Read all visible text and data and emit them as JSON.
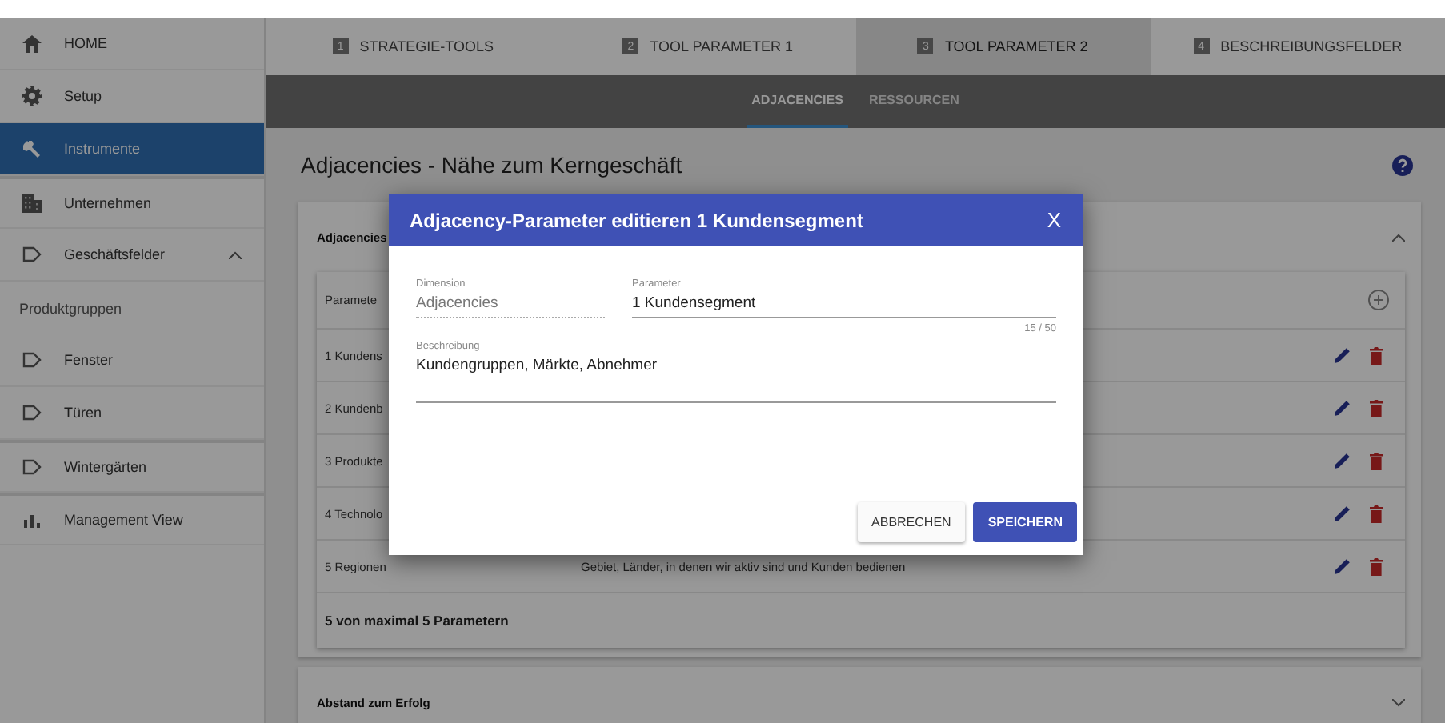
{
  "sidebar": {
    "items": [
      {
        "kind": "link",
        "label": "HOME",
        "selected": false
      },
      {
        "kind": "link",
        "label": "Setup",
        "selected": false
      },
      {
        "kind": "link",
        "label": "Instrumente",
        "selected": true
      },
      {
        "kind": "link",
        "label": "Unternehmen",
        "selected": false
      },
      {
        "kind": "group",
        "label": "Geschäftsfelder",
        "selected": false,
        "expanded": true
      },
      {
        "kind": "subheader",
        "label": "Produktgruppen"
      },
      {
        "kind": "link",
        "label": "Fenster",
        "selected": false
      },
      {
        "kind": "link",
        "label": "Türen",
        "selected": false
      },
      {
        "kind": "link",
        "label": "Wintergärten",
        "selected": false
      },
      {
        "kind": "link",
        "label": "Management View",
        "selected": false
      }
    ]
  },
  "tabs": [
    {
      "number": "1",
      "label": "STRATEGIE-TOOLS",
      "selected": false
    },
    {
      "number": "2",
      "label": "TOOL PARAMETER 1",
      "selected": false
    },
    {
      "number": "3",
      "label": "TOOL PARAMETER 2",
      "selected": true
    },
    {
      "number": "4",
      "label": "BESCHREIBUNGSFELDER",
      "selected": false
    }
  ],
  "subtabs": [
    {
      "label": "ADJACENCIES",
      "selected": true
    },
    {
      "label": "RESSOURCEN",
      "selected": false
    }
  ],
  "page_title": "Adjacencies - Nähe zum Kerngeschäft",
  "panels": [
    {
      "title": "Adjacencies",
      "expanded": true,
      "table": {
        "header": "Paramete",
        "rows": [
          {
            "label": "1 Kundens"
          },
          {
            "label": "2 Kundenb"
          },
          {
            "label": "3 Produkte"
          },
          {
            "label": "4 Technolo"
          },
          {
            "label": "5 Regionen",
            "description": "Gebiet, Länder, in denen wir aktiv sind und Kunden bedienen"
          }
        ],
        "footer": "5 von maximal 5 Parametern"
      }
    },
    {
      "title": "Abstand zum Erfolg",
      "expanded": false
    }
  ],
  "dialog": {
    "title": "Adjacency-Parameter editieren 1 Kundensegment",
    "close": "X",
    "fields": [
      {
        "label": "Dimension",
        "value": "Adjacencies",
        "disabled": true
      },
      {
        "label": "Parameter",
        "value": "1 Kundensegment",
        "disabled": false,
        "counter": "15 / 50"
      },
      {
        "label": "Beschreibung",
        "value": "Kundengruppen, Märkte, Abnehmer",
        "disabled": false
      }
    ],
    "buttons": [
      {
        "label": "ABBRECHEN",
        "kind": "flat"
      },
      {
        "label": "SPEICHERN",
        "kind": "primary"
      }
    ]
  }
}
